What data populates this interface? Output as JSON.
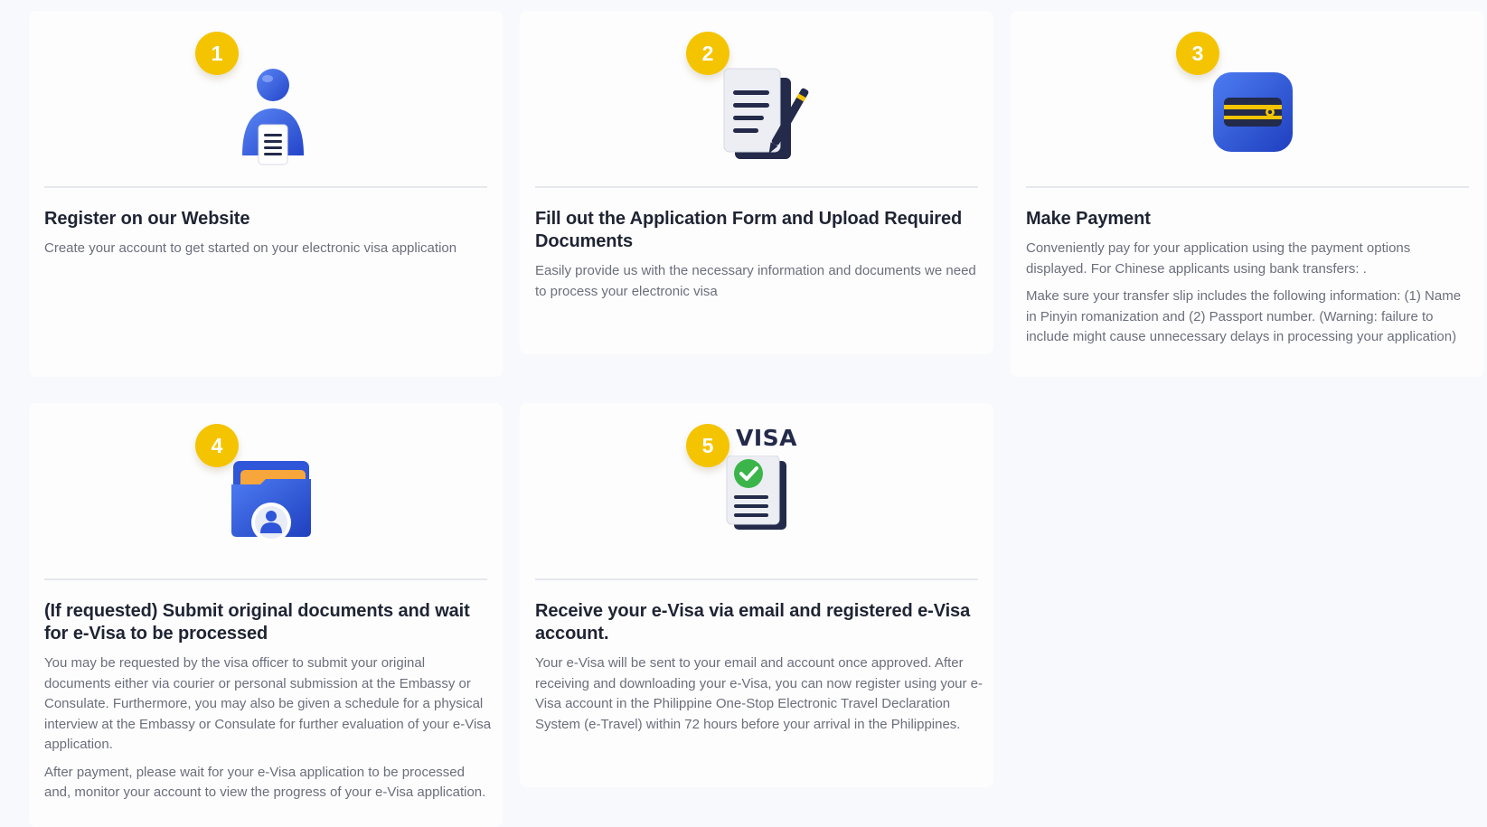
{
  "steps": [
    {
      "number": "1",
      "icon": "user-document-icon",
      "title": "Register on our Website",
      "paragraphs": [
        "Create your account to get started on your electronic visa application"
      ]
    },
    {
      "number": "2",
      "icon": "form-pen-icon",
      "title": "Fill out the Application Form and Upload Required Documents",
      "paragraphs": [
        "Easily provide us with the necessary information and documents we need to process your electronic visa"
      ]
    },
    {
      "number": "3",
      "icon": "wallet-card-icon",
      "title": "Make Payment",
      "paragraphs": [
        "Conveniently pay for your application using the payment options displayed. For Chinese applicants using bank transfers: .",
        "Make sure your transfer slip includes the following information: (1) Name in Pinyin romanization and (2) Passport number. (Warning: failure to include might cause unnecessary delays in processing your application)"
      ]
    },
    {
      "number": "4",
      "icon": "folder-user-icon",
      "title": "(If requested) Submit original documents and wait for e-Visa to be processed",
      "paragraphs": [
        "You may be requested by the visa officer to submit your original documents either via courier or personal submission at the Embassy or Consulate. Furthermore, you may also be given a schedule for a physical interview at the Embassy or Consulate for further evaluation of your e-Visa application.",
        "After payment, please wait for your e-Visa application to be processed and, monitor your account to view the progress of your e-Visa application."
      ]
    },
    {
      "number": "5",
      "icon": "visa-approved-document-icon",
      "visa_label": "VISA",
      "title": "Receive your e-Visa via email and registered e-Visa account.",
      "paragraphs": [
        "Your e-Visa will be sent to your email and account once approved. After receiving and downloading your e-Visa, you can now register using your e-Visa account in the Philippine One-Stop Electronic Travel Declaration System (e-Travel) within 72 hours before your arrival in the Philippines."
      ]
    }
  ],
  "colors": {
    "badge": "#f5c400",
    "icon_blue": "#2f56d8",
    "icon_navy": "#232a4a",
    "check_green": "#3bb54a",
    "folder_orange": "#f6a63a"
  }
}
